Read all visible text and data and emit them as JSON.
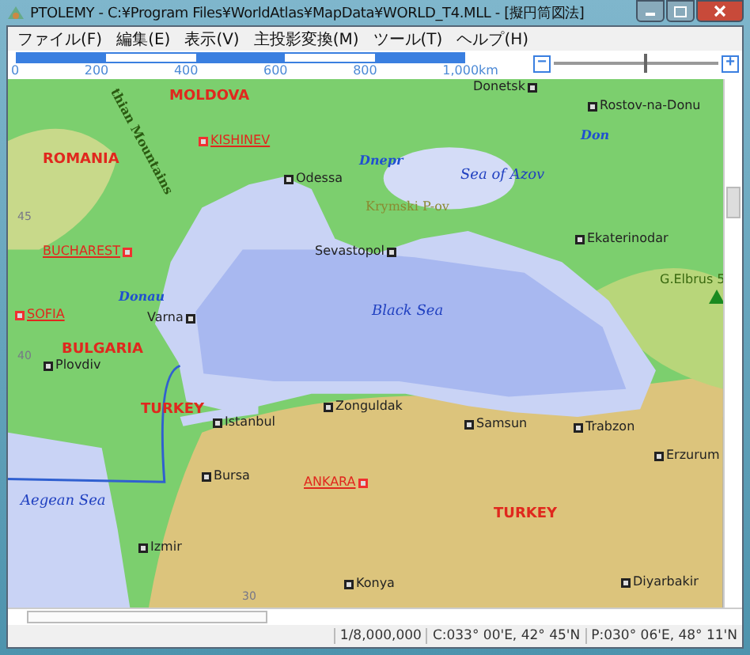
{
  "window": {
    "title": "PTOLEMY - C:¥Program Files¥WorldAtlas¥MapData¥WORLD_T4.MLL - [擬円筒図法]"
  },
  "menu": [
    "ファイル(F)",
    "編集(E)",
    "表示(V)",
    "主投影変換(M)",
    "ツール(T)",
    "ヘルプ(H)"
  ],
  "scale_bar": {
    "ticks": [
      "0",
      "200",
      "400",
      "600",
      "800",
      "1,000km"
    ]
  },
  "zoom": {
    "minus": "−",
    "plus": "+",
    "level": 0.55
  },
  "map": {
    "labels": [
      {
        "kind": "country",
        "text": "MOLDOVA"
      },
      {
        "kind": "country",
        "text": "ROMANIA"
      },
      {
        "kind": "country",
        "text": "BULGARIA"
      },
      {
        "kind": "country",
        "text": "TURKEY"
      },
      {
        "kind": "country",
        "text": "TURKEY"
      },
      {
        "kind": "capital",
        "text": "KISHINEV"
      },
      {
        "kind": "capital",
        "text": "BUCHAREST"
      },
      {
        "kind": "capital",
        "text": "SOFIA"
      },
      {
        "kind": "capital",
        "text": "ANKARA"
      },
      {
        "kind": "city",
        "text": "Donetsk"
      },
      {
        "kind": "city",
        "text": "Rostov-na-Donu"
      },
      {
        "kind": "city",
        "text": "Odessa"
      },
      {
        "kind": "city",
        "text": "Sevastopol"
      },
      {
        "kind": "city",
        "text": "Ekaterinodar"
      },
      {
        "kind": "city",
        "text": "Varna"
      },
      {
        "kind": "city",
        "text": "Plovdiv"
      },
      {
        "kind": "city",
        "text": "Zonguldak"
      },
      {
        "kind": "city",
        "text": "Istanbul"
      },
      {
        "kind": "city",
        "text": "Bursa"
      },
      {
        "kind": "city",
        "text": "Samsun"
      },
      {
        "kind": "city",
        "text": "Trabzon"
      },
      {
        "kind": "city",
        "text": "Erzurum"
      },
      {
        "kind": "city",
        "text": "Izmir"
      },
      {
        "kind": "city",
        "text": "Konya"
      },
      {
        "kind": "city",
        "text": "Diyarbakir"
      },
      {
        "kind": "sea",
        "text": "Black Sea"
      },
      {
        "kind": "sea",
        "text": "Sea of Azov"
      },
      {
        "kind": "sea",
        "text": "Aegean Sea"
      },
      {
        "kind": "river",
        "text": "Dnepr"
      },
      {
        "kind": "river",
        "text": "Don"
      },
      {
        "kind": "river",
        "text": "Donau"
      },
      {
        "kind": "region",
        "text": "Krymski P-ov"
      },
      {
        "kind": "mountain",
        "text": "thian Mountains"
      },
      {
        "kind": "peak",
        "text": "G.Elbrus 5"
      },
      {
        "kind": "grid",
        "text": "45"
      },
      {
        "kind": "grid",
        "text": "40"
      },
      {
        "kind": "grid",
        "text": "30"
      }
    ]
  },
  "status_bar": [
    "1/8,000,000",
    "C:033° 00'E, 42° 45'N",
    "P:030° 06'E, 48° 11'N"
  ]
}
